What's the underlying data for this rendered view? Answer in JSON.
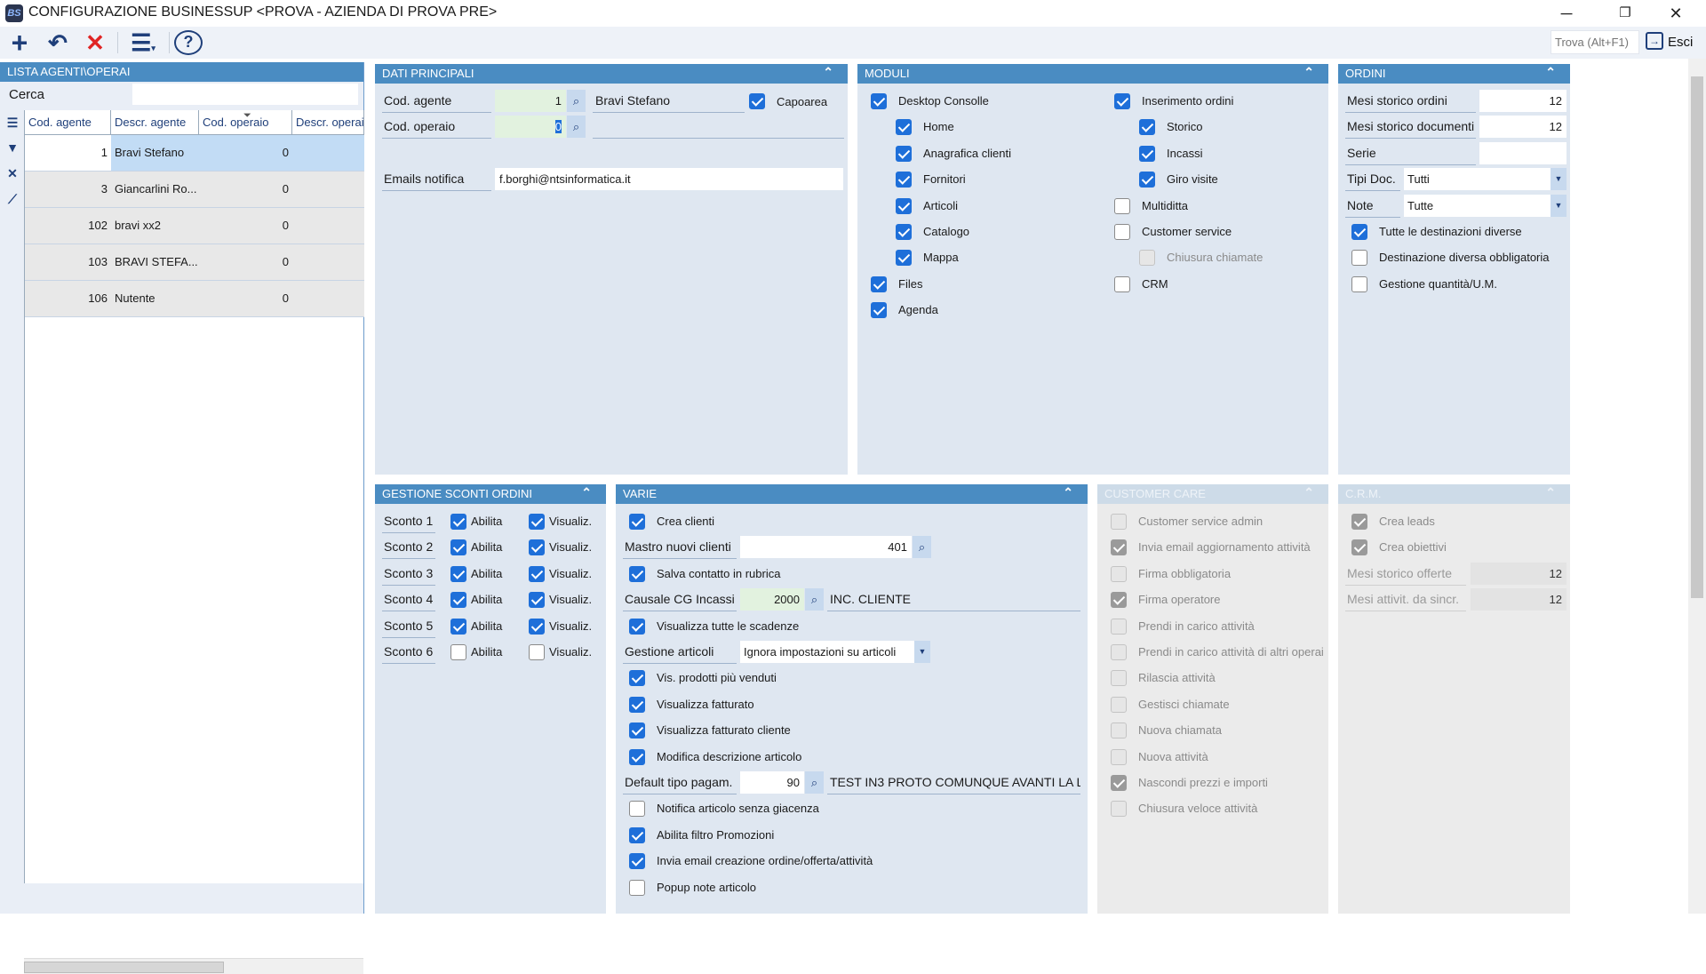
{
  "window": {
    "title": "CONFIGURAZIONE BUSINESSUP <PROVA - AZIENDA DI PROVA PRE>",
    "app_icon": "BS",
    "minimize": "─",
    "maximize": "❐",
    "close": "✕"
  },
  "toolbar": {
    "new": "+",
    "undo": "↶",
    "delete": "✕",
    "menu": "☰",
    "help": "?",
    "find_placeholder": "Trova (Alt+F1)",
    "exit_label": "Esci"
  },
  "left": {
    "title": "LISTA AGENTI\\OPERAI",
    "search_label": "Cerca",
    "search_value": "",
    "columns": [
      "Cod. agente",
      "Descr. agente",
      "Cod. operaio",
      "Descr. operai"
    ],
    "rows": [
      [
        "1",
        "Bravi Stefano",
        "0",
        ""
      ],
      [
        "3",
        "Giancarlini Ro...",
        "0",
        ""
      ],
      [
        "102",
        "bravi xx2",
        "0",
        ""
      ],
      [
        "103",
        "BRAVI STEFA...",
        "0",
        ""
      ],
      [
        "106",
        "Nutente",
        "0",
        ""
      ]
    ]
  },
  "dati": {
    "title": "DATI PRINCIPALI",
    "cod_agente_label": "Cod. agente",
    "cod_agente": "1",
    "agente_desc": "Bravi Stefano",
    "capoarea_label": "Capoarea",
    "capoarea": true,
    "cod_operaio_label": "Cod. operaio",
    "cod_operaio": "0",
    "operaio_desc": "",
    "emails_label": "Emails notifica",
    "emails": "f.borghi@ntsinformatica.it"
  },
  "moduli": {
    "title": "MODULI",
    "col1": [
      {
        "label": "Desktop Consolle",
        "checked": true
      },
      {
        "label": "Home",
        "checked": true,
        "indent": true
      },
      {
        "label": "Anagrafica clienti",
        "checked": true,
        "indent": true
      },
      {
        "label": "Fornitori",
        "checked": true,
        "indent": true
      },
      {
        "label": "Articoli",
        "checked": true,
        "indent": true
      },
      {
        "label": "Catalogo",
        "checked": true,
        "indent": true
      },
      {
        "label": "Mappa",
        "checked": true,
        "indent": true
      },
      {
        "label": "Files",
        "checked": true
      },
      {
        "label": "Agenda",
        "checked": true
      }
    ],
    "col2": [
      {
        "label": "Inserimento ordini",
        "checked": true
      },
      {
        "label": "Storico",
        "checked": true,
        "indent": true
      },
      {
        "label": "Incassi",
        "checked": true,
        "indent": true
      },
      {
        "label": "Giro visite",
        "checked": true,
        "indent": true
      },
      {
        "label": "Multiditta",
        "checked": false
      },
      {
        "label": "Customer service",
        "checked": false
      },
      {
        "label": "Chiusura chiamate",
        "checked": false,
        "indent": true,
        "disabled": true
      },
      {
        "label": "CRM",
        "checked": false
      }
    ]
  },
  "ordini": {
    "title": "ORDINI",
    "fields": [
      {
        "label": "Mesi storico ordini",
        "value": "12"
      },
      {
        "label": "Mesi storico documenti",
        "value": "12"
      },
      {
        "label": "Serie",
        "value": ""
      }
    ],
    "selects": [
      {
        "label": "Tipi Doc.",
        "value": "Tutti"
      },
      {
        "label": "Note",
        "value": "Tutte"
      }
    ],
    "checks": [
      {
        "label": "Tutte le destinazioni diverse",
        "checked": true
      },
      {
        "label": "Destinazione diversa obbligatoria",
        "checked": false
      },
      {
        "label": "Gestione quantità/U.M.",
        "checked": false
      }
    ]
  },
  "sconti": {
    "title": "GESTIONE SCONTI ORDINI",
    "enable_label": "Abilita",
    "show_label": "Visualiz.",
    "rows": [
      {
        "label": "Sconto 1",
        "enable": true,
        "show": true
      },
      {
        "label": "Sconto 2",
        "enable": true,
        "show": true
      },
      {
        "label": "Sconto 3",
        "enable": true,
        "show": true
      },
      {
        "label": "Sconto 4",
        "enable": true,
        "show": true
      },
      {
        "label": "Sconto 5",
        "enable": true,
        "show": true
      },
      {
        "label": "Sconto 6",
        "enable": false,
        "show": false
      }
    ]
  },
  "varie": {
    "title": "VARIE",
    "items": [
      {
        "type": "check",
        "label": "Crea clienti",
        "checked": true
      },
      {
        "type": "field",
        "label": "Mastro nuovi clienti",
        "value": "401",
        "wide": true
      },
      {
        "type": "check",
        "label": "Salva contatto in rubrica",
        "checked": true
      },
      {
        "type": "field",
        "label": "Causale CG Incassi",
        "value": "2000",
        "green": true,
        "desc": "INC. CLIENTE"
      },
      {
        "type": "check",
        "label": "Visualizza tutte le scadenze",
        "checked": true
      },
      {
        "type": "select",
        "label": "Gestione articoli",
        "value": "Ignora impostazioni su articoli"
      },
      {
        "type": "check",
        "label": "Vis. prodotti più venduti",
        "checked": true
      },
      {
        "type": "check",
        "label": "Visualizza fatturato",
        "checked": true
      },
      {
        "type": "check",
        "label": "Visualizza fatturato cliente",
        "checked": true
      },
      {
        "type": "check",
        "label": "Modifica descrizione articolo",
        "checked": true
      },
      {
        "type": "field",
        "label": "Default tipo pagam.",
        "value": "90",
        "desc": "TEST IN3 PROTO COMUNQUE AVANTI LA L..."
      },
      {
        "type": "check",
        "label": "Notifica articolo senza giacenza",
        "checked": false
      },
      {
        "type": "check",
        "label": "Abilita filtro Promozioni",
        "checked": true
      },
      {
        "type": "check",
        "label": "Invia email creazione ordine/offerta/attività",
        "checked": true
      },
      {
        "type": "check",
        "label": "Popup note articolo",
        "checked": false
      }
    ]
  },
  "customer_care": {
    "title": "CUSTOMER CARE",
    "items": [
      {
        "label": "Customer service admin",
        "checked": false
      },
      {
        "label": "Invia email aggiornamento attività",
        "checked": true
      },
      {
        "label": "Firma obbligatoria",
        "checked": false
      },
      {
        "label": "Firma operatore",
        "checked": true
      },
      {
        "label": "Prendi in carico attività",
        "checked": false
      },
      {
        "label": "Prendi in carico attività di altri operai",
        "checked": false
      },
      {
        "label": "Rilascia attività",
        "checked": false
      },
      {
        "label": "Gestisci chiamate",
        "checked": false
      },
      {
        "label": "Nuova chiamata",
        "checked": false
      },
      {
        "label": "Nuova attività",
        "checked": false
      },
      {
        "label": "Nascondi prezzi e importi",
        "checked": true
      },
      {
        "label": "Chiusura veloce attività",
        "checked": false
      }
    ]
  },
  "crm": {
    "title": "C.R.M.",
    "checks": [
      {
        "label": "Crea leads",
        "checked": true
      },
      {
        "label": "Crea obiettivi",
        "checked": true
      }
    ],
    "fields": [
      {
        "label": "Mesi storico offerte",
        "value": "12"
      },
      {
        "label": "Mesi attivit. da sincr.",
        "value": "12"
      }
    ]
  },
  "colors": {
    "header": "#4a8cc2",
    "panel": "#dfe7f1",
    "check": "#1e6fd9",
    "selected_row": "#c2dcf5"
  }
}
